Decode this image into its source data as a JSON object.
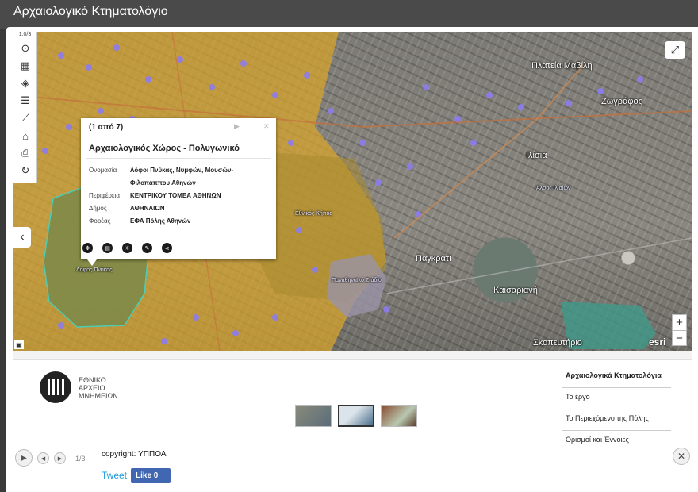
{
  "window": {
    "title": "Αρχαιολογικό Κτηματολόγιο"
  },
  "toolbar": {
    "top_label": "1:0/3",
    "icons": [
      "locate-icon",
      "grid-icon",
      "layers-icon",
      "list-icon",
      "ruler-icon",
      "measure-icon",
      "print-icon",
      "refresh-icon"
    ]
  },
  "map": {
    "labels": [
      {
        "text": "Ζωγράφος",
        "cls": ""
      },
      {
        "text": "Παγκράτι",
        "cls": ""
      },
      {
        "text": "Καισαριανή",
        "cls": ""
      },
      {
        "text": "Πλατεία Μαβίλη",
        "cls": ""
      },
      {
        "text": "Ιλίσια",
        "cls": ""
      },
      {
        "text": "Άλσος Ιλισίων",
        "cls": "small"
      },
      {
        "text": "Λόφος Πνύκας",
        "cls": "small"
      },
      {
        "text": "Εθνικός Κήπος",
        "cls": "small"
      },
      {
        "text": "Σκοπευτήριο",
        "cls": ""
      },
      {
        "text": "Παναθηναϊκό Στάδιο",
        "cls": "small"
      }
    ],
    "attribution": "esri",
    "zoom_in": "+",
    "zoom_out": "−"
  },
  "popup": {
    "count": "(1 από 7)",
    "title": "Αρχαιολογικός Χώρος - Πολυγωνικό",
    "rows": [
      {
        "key": "Ονομασία",
        "value": "Λόφοι Πνύκας, Νυμφών, Μουσών-Φιλοπάππου Αθηνών"
      },
      {
        "key": "Περιφέρεια",
        "value": "ΚΕΝΤΡΙΚΟΥ ΤΟΜΕΑ ΑΘΗΝΩΝ"
      },
      {
        "key": "Δήμος",
        "value": "ΑΘΗΝΑΙΩΝ"
      },
      {
        "key": "Φορέας",
        "value": "ΕΦΑ Πόλης Αθηνών"
      }
    ]
  },
  "logo": {
    "line1": "ΕΘΝΙΚΟ",
    "line2": "ΑΡΧΕΙΟ",
    "line3": "ΜΝΗΜΕΙΩΝ"
  },
  "menu": {
    "items": [
      "Αρχαιολογικά Κτηματολόγια",
      "Το έργο",
      "Το Περιεχόμενο της Πύλης",
      "Ορισμοί και Έννοιες"
    ]
  },
  "lightbox": {
    "counter": "1/3",
    "copyright": "copyright: ΥΠΠΟΑ",
    "tweet": "Tweet",
    "like": "Like 0"
  }
}
